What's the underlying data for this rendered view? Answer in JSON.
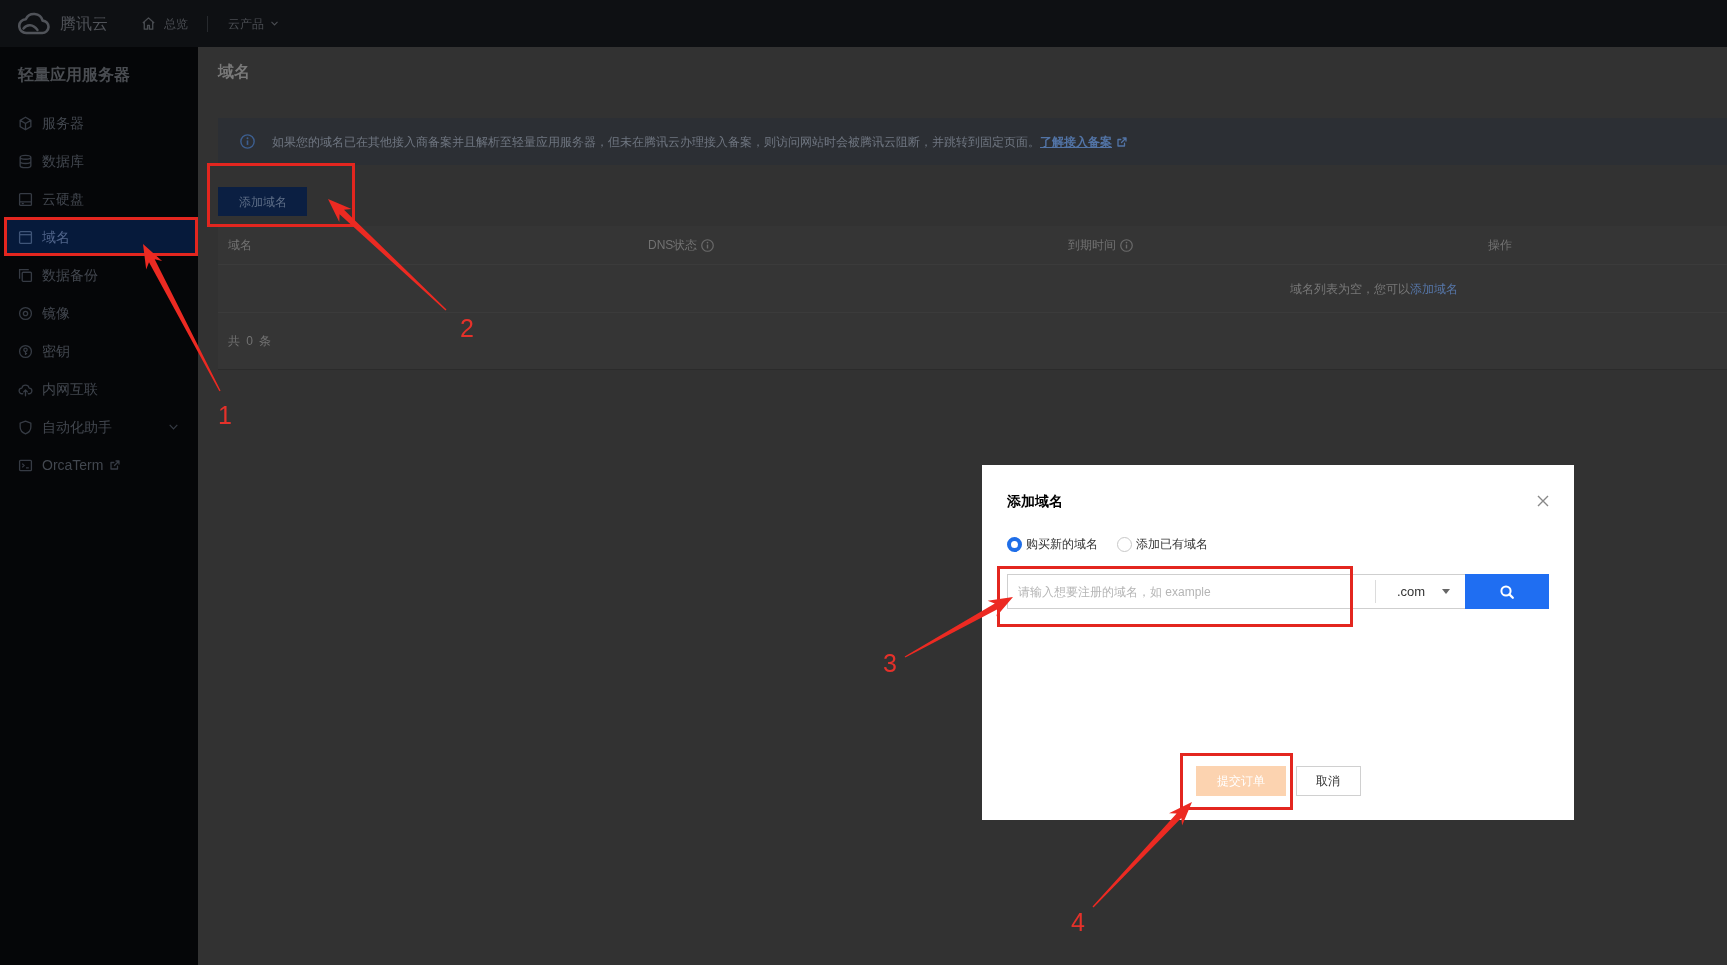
{
  "top_bar": {
    "brand": "腾讯云",
    "nav": [
      {
        "label": "总览",
        "kind": "home"
      },
      {
        "label": "云产品",
        "kind": "menu"
      }
    ]
  },
  "sidebar": {
    "title": "轻量应用服务器",
    "items": [
      {
        "label": "服务器",
        "kind": "page",
        "selected": false
      },
      {
        "label": "数据库",
        "kind": "page",
        "selected": false
      },
      {
        "label": "云硬盘",
        "kind": "page",
        "selected": false
      },
      {
        "label": "域名",
        "kind": "page",
        "selected": true
      },
      {
        "label": "数据备份",
        "kind": "page",
        "selected": false
      },
      {
        "label": "镜像",
        "kind": "page",
        "selected": false
      },
      {
        "label": "密钥",
        "kind": "page",
        "selected": false
      },
      {
        "label": "内网互联",
        "kind": "page",
        "selected": false
      },
      {
        "label": "自动化助手",
        "kind": "group",
        "selected": false
      },
      {
        "label": "OrcaTerm",
        "kind": "external",
        "selected": false
      }
    ]
  },
  "page": {
    "title": "域名",
    "notice": {
      "text": "如果您的域名已在其他接入商备案并且解析至轻量应用服务器，但未在腾讯云办理接入备案，则访问网站时会被腾讯云阻断，并跳转到固定页面。",
      "link": "了解接入备案"
    },
    "add_button": "添加域名",
    "table": {
      "columns": [
        {
          "label": "域名",
          "info": false
        },
        {
          "label": "DNS状态",
          "info": true
        },
        {
          "label": "到期时间",
          "info": true
        },
        {
          "label": "操作",
          "info": false
        }
      ],
      "empty_text": "域名列表为空，您可以",
      "empty_link": "添加域名",
      "total": "共 0 条"
    }
  },
  "dialog": {
    "title": "添加域名",
    "options": [
      {
        "label": "购买新的域名",
        "selected": true
      },
      {
        "label": "添加已有域名",
        "selected": false
      }
    ],
    "domain_field": {
      "placeholder": "请输入想要注册的域名，如 example"
    },
    "suffix": ".com",
    "buttons": [
      {
        "label": "提交订单",
        "kind": "primary",
        "disabled": true
      },
      {
        "label": "取消",
        "kind": "secondary",
        "disabled": false
      }
    ]
  },
  "annotations": [
    {
      "number": "1"
    },
    {
      "number": "2"
    },
    {
      "number": "3"
    },
    {
      "number": "4"
    }
  ]
}
